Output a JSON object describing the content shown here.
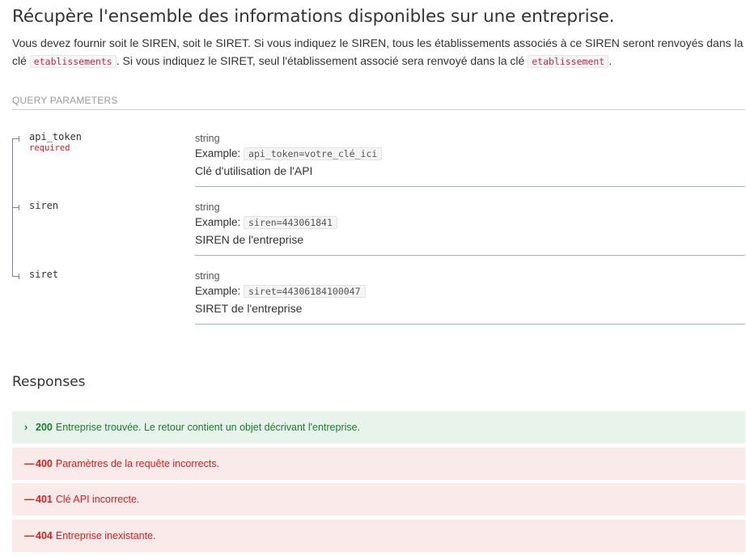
{
  "title": "Récupère l'ensemble des informations disponibles sur une entreprise.",
  "description": {
    "part1": "Vous devez fournir soit le SIREN, soit le SIRET. Si vous indiquez le SIREN, tous les établissements associés à ce SIREN seront renvoyés dans la clé ",
    "code1": "etablissements",
    "part2": ". Si vous indiquez le SIRET, seul l'établissement associé sera renvoyé dans la clé ",
    "code2": "etablissement",
    "part3": "."
  },
  "query_parameters_label": "QUERY PARAMETERS",
  "parameters": [
    {
      "name": "api_token",
      "required_label": "required",
      "type": "string",
      "example_label": "Example:",
      "example": "api_token=votre_clé_ici",
      "description": "Clé d'utilisation de l'API"
    },
    {
      "name": "siren",
      "type": "string",
      "example_label": "Example:",
      "example": "siren=443061841",
      "description": "SIREN de l'entreprise"
    },
    {
      "name": "siret",
      "type": "string",
      "example_label": "Example:",
      "example": "siret=44306184100047",
      "description": "SIRET de l'entreprise"
    }
  ],
  "responses_title": "Responses",
  "responses": [
    {
      "icon": "chevron-right-icon",
      "symbol": "›",
      "code": "200",
      "text": "Entreprise trouvée. Le retour contient un objet décrivant l'entreprise.",
      "status": "success",
      "color": "#1a7e2c"
    },
    {
      "icon": "dash-icon",
      "symbol": "—",
      "code": "400",
      "text": "Paramètres de la requête incorrects.",
      "status": "error",
      "color": "#d41f1c"
    },
    {
      "icon": "dash-icon",
      "symbol": "—",
      "code": "401",
      "text": "Clé API incorrecte.",
      "status": "error",
      "color": "#d41f1c"
    },
    {
      "icon": "dash-icon",
      "symbol": "—",
      "code": "404",
      "text": "Entreprise inexistante.",
      "status": "error",
      "color": "#d41f1c"
    }
  ]
}
